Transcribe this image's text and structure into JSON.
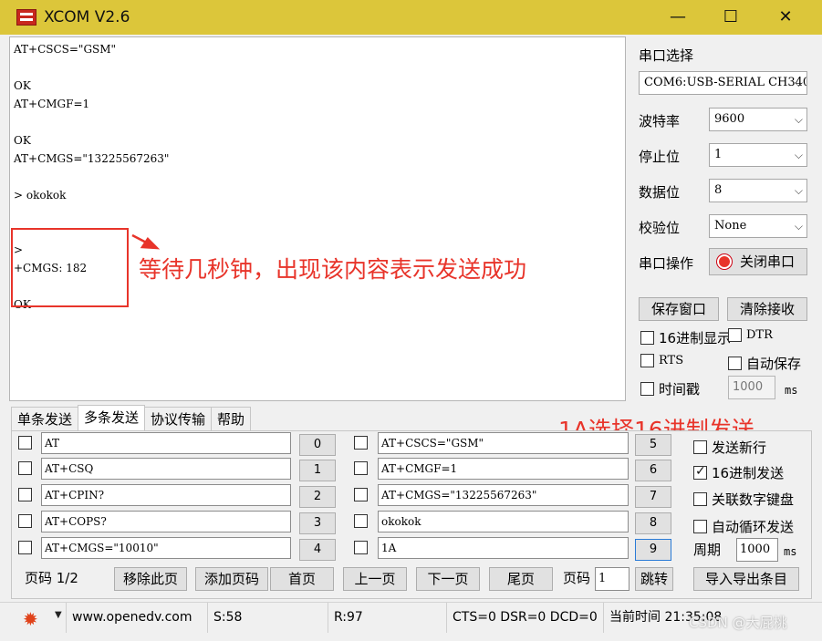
{
  "window": {
    "title": "XCOM V2.6",
    "minimize": "—",
    "maximize": "☐",
    "close": "✕"
  },
  "receive": {
    "lines": [
      "AT+CSCS=\"GSM\"",
      "",
      "OK",
      "AT+CMGF=1",
      "",
      "OK",
      "AT+CMGS=\"13225567263\"",
      "",
      "> okokok",
      "",
      "",
      ">",
      "+CMGS: 182",
      "",
      "OK"
    ]
  },
  "annotations": {
    "success_note": "等待几秒钟，出现该内容表示发送成功",
    "hex_note": "1A选择16进制发送"
  },
  "serial": {
    "port_label": "串口选择",
    "port_value": "COM6:USB-SERIAL CH340",
    "baud_label": "波特率",
    "baud_value": "9600",
    "stop_label": "停止位",
    "stop_value": "1",
    "data_label": "数据位",
    "data_value": "8",
    "parity_label": "校验位",
    "parity_value": "None",
    "op_label": "串口操作",
    "close_port_button": "关闭串口",
    "save_window_button": "保存窗口",
    "clear_receive_button": "清除接收",
    "hex_display_label": "16进制显示",
    "hex_display_checked": false,
    "dtr_label": "DTR",
    "dtr_checked": false,
    "rts_label": "RTS",
    "rts_checked": false,
    "auto_save_label": "自动保存",
    "auto_save_checked": false,
    "timestamp_label": "时间戳",
    "timestamp_checked": false,
    "timestamp_ms_value": "1000",
    "ms_unit": "ms",
    "accent_color": "#e8342a"
  },
  "tabs": [
    {
      "label": "单条发送",
      "active": false
    },
    {
      "label": "多条发送",
      "active": true
    },
    {
      "label": "协议传输",
      "active": false
    },
    {
      "label": "帮助",
      "active": false
    }
  ],
  "multi_send": {
    "left_rows": [
      {
        "text": "AT",
        "num": "0"
      },
      {
        "text": "AT+CSQ",
        "num": "1"
      },
      {
        "text": "AT+CPIN?",
        "num": "2"
      },
      {
        "text": "AT+COPS?",
        "num": "3"
      },
      {
        "text": "AT+CMGS=\"10010\"",
        "num": "4"
      }
    ],
    "right_rows": [
      {
        "text": "AT+CSCS=\"GSM\"",
        "num": "5"
      },
      {
        "text": "AT+CMGF=1",
        "num": "6"
      },
      {
        "text": "AT+CMGS=\"13225567263\"",
        "num": "7"
      },
      {
        "text": "okokok",
        "num": "8"
      },
      {
        "text": "1A",
        "num": "9"
      }
    ],
    "send_newline_label": "发送新行",
    "send_newline_checked": false,
    "hex_send_label": "16进制发送",
    "hex_send_checked": true,
    "numpad_label": "关联数字键盘",
    "numpad_checked": false,
    "auto_loop_label": "自动循环发送",
    "auto_loop_checked": false,
    "period_label": "周期",
    "period_value": "1000",
    "period_unit": "ms"
  },
  "paging": {
    "page_info": "页码 1/2",
    "remove_page": "移除此页",
    "add_page": "添加页码",
    "first_page": "首页",
    "prev_page": "上一页",
    "next_page": "下一页",
    "last_page": "尾页",
    "page_label": "页码",
    "page_input": "1",
    "jump": "跳转",
    "import_export": "导入导出条目"
  },
  "status": {
    "url": "www.openedv.com",
    "sent": "S:58",
    "received": "R:97",
    "lines_state": "CTS=0 DSR=0 DCD=0",
    "time": "当前时间 21:35:08"
  },
  "watermark": "CSDN @大屁桃"
}
